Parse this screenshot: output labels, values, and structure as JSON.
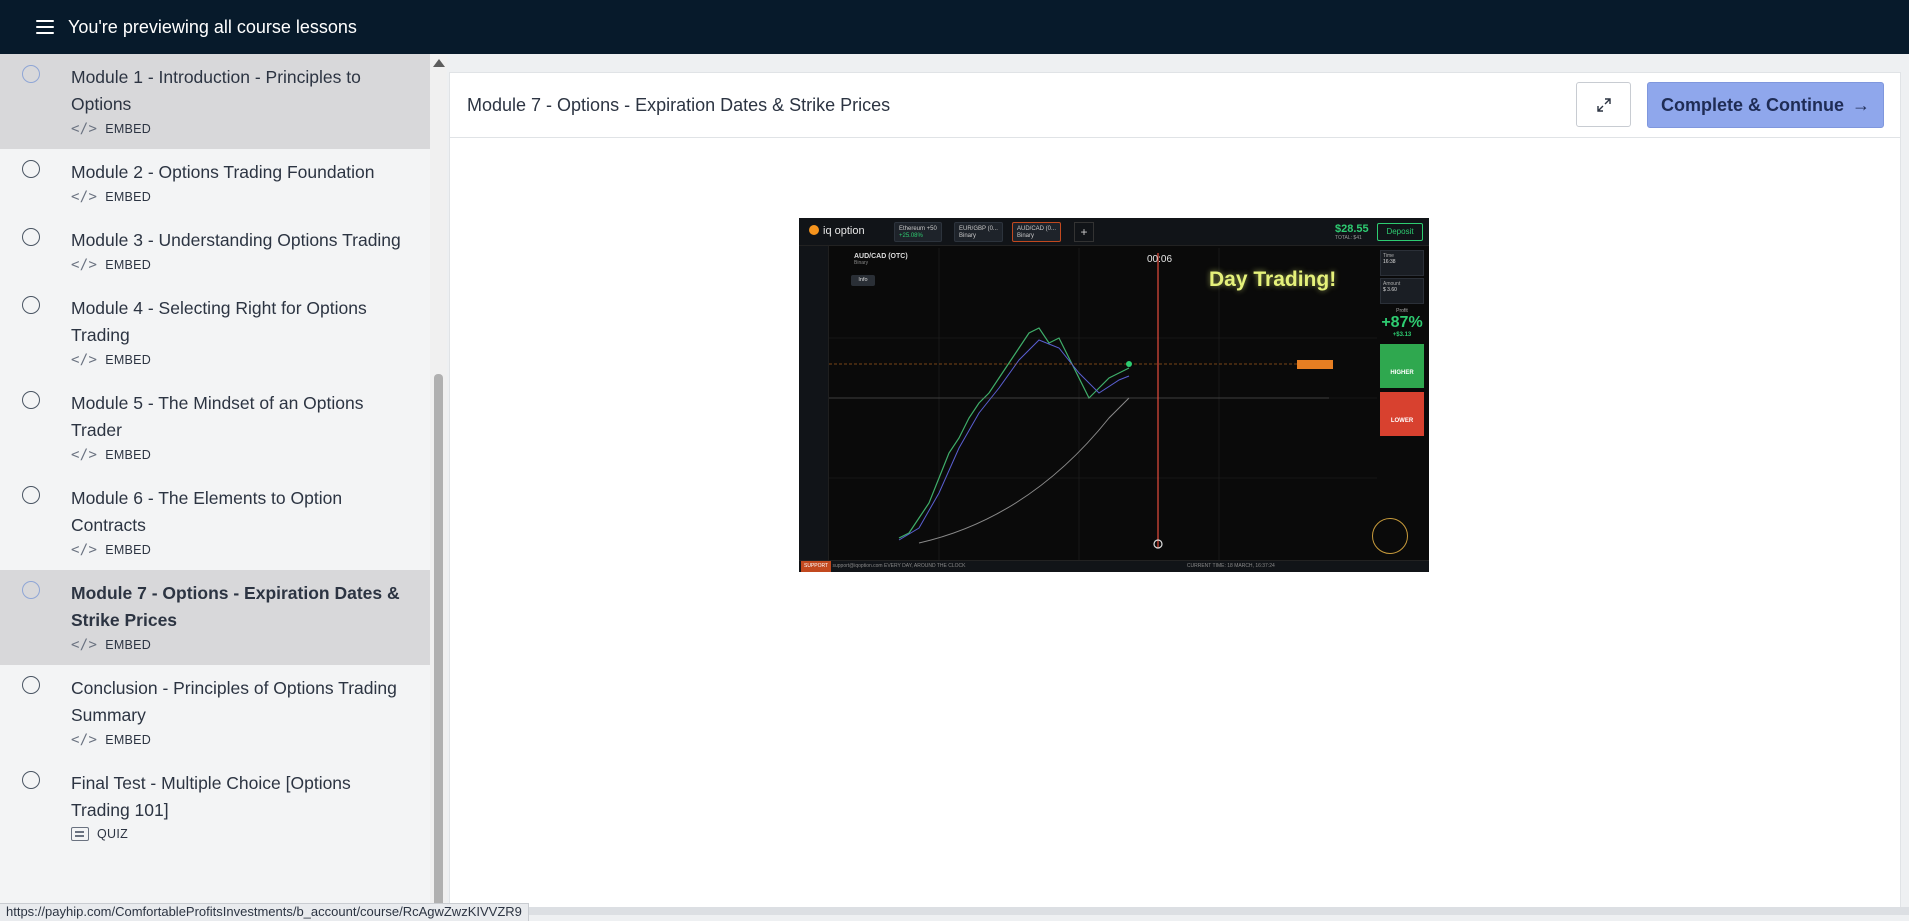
{
  "topbar": {
    "title": "You're previewing all course lessons"
  },
  "sidebar": {
    "lessons": [
      {
        "title": "Module 1 - Introduction - Principles to Options",
        "type": "EMBED"
      },
      {
        "title": "Module 2 - Options Trading Foundation",
        "type": "EMBED"
      },
      {
        "title": "Module 3 - Understanding Options Trading",
        "type": "EMBED"
      },
      {
        "title": "Module 4 - Selecting Right for Options Trading",
        "type": "EMBED"
      },
      {
        "title": "Module 5 - The Mindset of an Options Trader",
        "type": "EMBED"
      },
      {
        "title": "Module 6 - The Elements to Option Contracts",
        "type": "EMBED"
      },
      {
        "title": "Module 7 - Options - Expiration Dates & Strike Prices",
        "type": "EMBED"
      },
      {
        "title": "Conclusion - Principles of Options Trading Summary",
        "type": "EMBED"
      },
      {
        "title": "Final Test - Multiple Choice [Options Trading 101]",
        "type": "QUIZ"
      }
    ]
  },
  "main": {
    "title": "Module 7 - Options - Expiration Dates & Strike Prices",
    "complete_label": "Complete & Continue",
    "complete_arrow": "→"
  },
  "video": {
    "logo": "iq option",
    "tabs": [
      {
        "label": "Ethereum +50",
        "sub": "+25.08%"
      },
      {
        "label": "EUR/GBP (0...",
        "sub": "Binary"
      },
      {
        "label": "AUD/CAD (0...",
        "sub": "Binary"
      }
    ],
    "plus": "+",
    "balance": "$28.55",
    "balance_sub": "TOTAL: $41",
    "deposit": "Deposit",
    "pair": "AUD/CAD (OTC)",
    "pair_sub": "Binary",
    "info": "Info",
    "timer": "00:06",
    "headline": "Day Trading!",
    "time_label": "Time",
    "time_value": "16:38",
    "amount_label": "Amount",
    "amount_value": "$ 3.60",
    "profit_label": "Profit",
    "profit": "+87%",
    "profit_sub": "+$3.13",
    "higher": "HIGHER",
    "lower": "LOWER",
    "support": "SUPPORT",
    "support_email": "support@iqoption.com",
    "support_tagline": "EVERY DAY, AROUND THE CLOCK",
    "current_time": "CURRENT TIME: 18 MARCH, 16:37:24"
  },
  "status_url": "https://payhip.com/ComfortableProfitsInvestments/b_account/course/RcAgwZwzKIVVZR9"
}
